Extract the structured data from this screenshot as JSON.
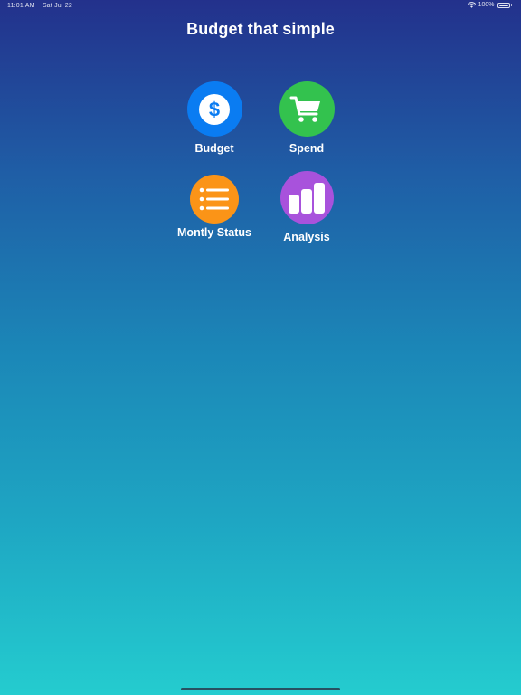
{
  "status_bar": {
    "time": "11:01 AM",
    "date": "Sat Jul 22",
    "battery": "100%",
    "wifi_icon": "wifi-icon",
    "battery_icon": "battery-icon"
  },
  "header": {
    "title": "Budget that simple"
  },
  "menu": {
    "items": [
      {
        "label": "Budget",
        "icon": "dollar-icon",
        "color": "#0a7cf2"
      },
      {
        "label": "Spend",
        "icon": "cart-icon",
        "color": "#33c24e"
      },
      {
        "label": "Montly Status",
        "icon": "list-icon",
        "color": "#fb9417"
      },
      {
        "label": "Analysis",
        "icon": "bar-chart-icon",
        "color": "#a852dc"
      }
    ]
  },
  "colors": {
    "gradient_top": "#23318c",
    "gradient_bottom": "#24cccf"
  }
}
